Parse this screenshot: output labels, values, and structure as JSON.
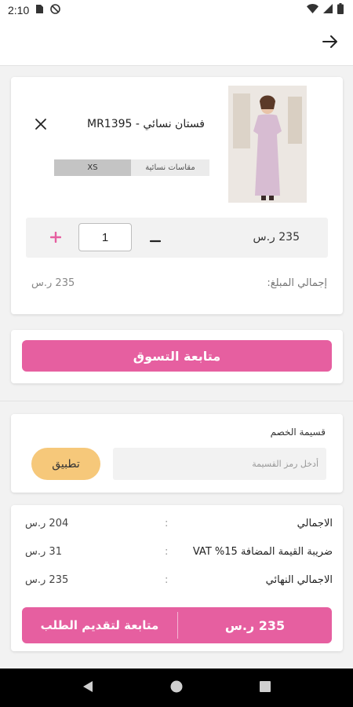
{
  "status_bar": {
    "time": "2:10",
    "icons": [
      "sim-card-icon",
      "no-sync-icon",
      "wifi-icon",
      "signal-icon",
      "battery-icon"
    ]
  },
  "app_bar": {
    "back_icon": "arrow-right-icon"
  },
  "cart": {
    "item": {
      "name": "فستان نسائي - MR1395",
      "size_label": "مقاسات نسائية",
      "size_value": "XS",
      "quantity": "1",
      "line_price": "235 ر.س"
    },
    "subtotal_label": "إجمالي المبلغ:",
    "subtotal_value": "235 ر.س"
  },
  "continue_shopping": {
    "label": "متابعة التسوق"
  },
  "coupon": {
    "label": "قسيمة الخصم",
    "placeholder": "أدخل رمز القسيمة",
    "apply_label": "تطبيق"
  },
  "summary": {
    "rows": [
      {
        "label": "الاجمالي",
        "colon": ":",
        "value": "204 ر.س"
      },
      {
        "label": "ضريبة القيمة المضافة 15% VAT",
        "colon": ":",
        "value": "31 ر.س"
      },
      {
        "label": "الاجمالي النهائي",
        "colon": ":",
        "value": "235 ر.س"
      }
    ],
    "checkout_label": "متابعة لتقديم الطلب",
    "checkout_total": "235 ر.س"
  },
  "colors": {
    "accent": "#e65fa0",
    "apply": "#f6c87a",
    "background": "#f2f2f2"
  },
  "nav_bar": {
    "icons": [
      "back-triangle-icon",
      "home-circle-icon",
      "recents-square-icon"
    ]
  }
}
